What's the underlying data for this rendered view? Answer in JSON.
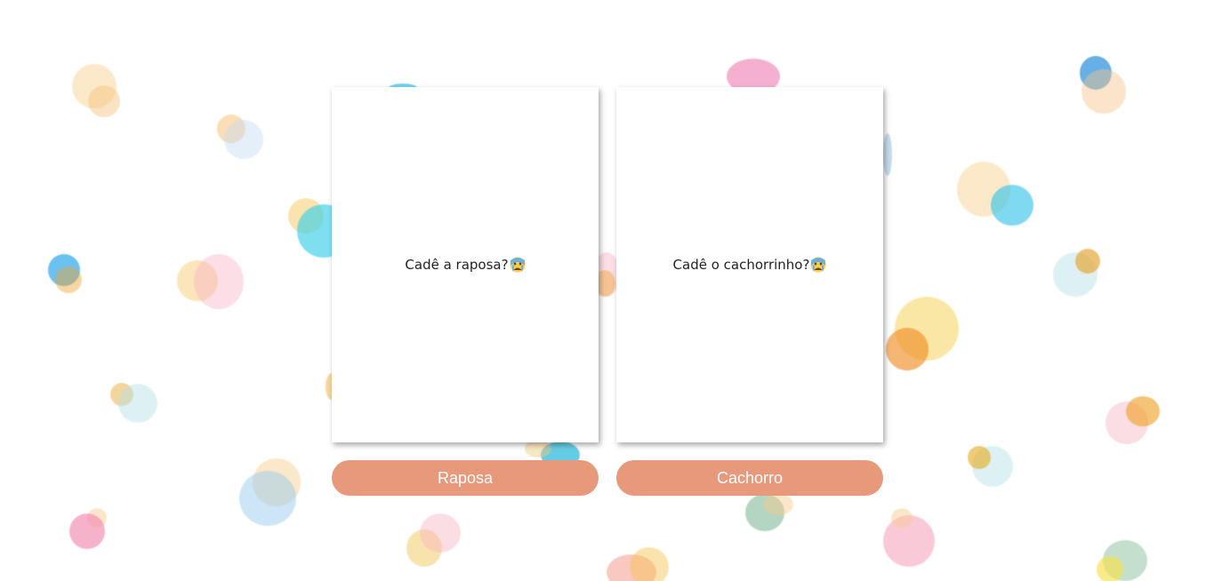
{
  "cards": [
    {
      "text": "Cadê a raposa?",
      "emoji_icon": "crying-face-emoji"
    },
    {
      "text": "Cadê o cachorrinho?",
      "emoji_icon": "crying-face-emoji"
    }
  ],
  "buttons": [
    {
      "label": "Raposa"
    },
    {
      "label": "Cachorro"
    }
  ],
  "colors": {
    "button_bg": "#e8987b",
    "button_text": "#ffffff",
    "card_bg": "#ffffff",
    "page_bg": "#ffffff"
  }
}
